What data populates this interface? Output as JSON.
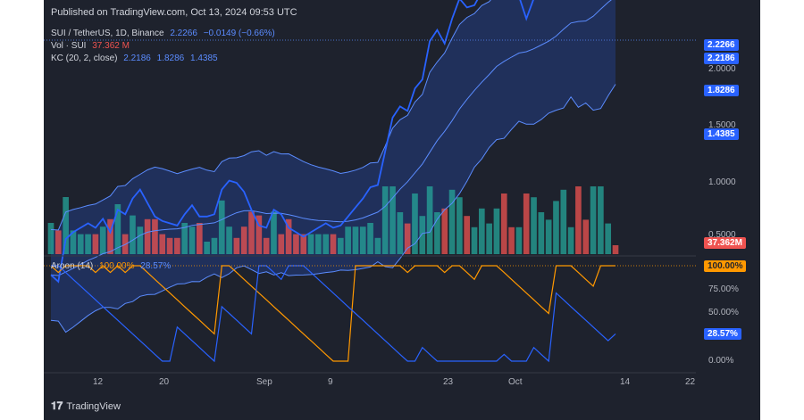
{
  "header": {
    "published": "Published on TradingView.com, Oct 13, 2024 09:53 UTC"
  },
  "legend": {
    "symbol": "SUI / TetherUS, 1D, Binance",
    "price": "2.2266",
    "change": "−0.0149 (−0.66%)",
    "vol_label": "Vol · SUI",
    "vol_value": "37.362 M",
    "kc_label": "KC (20, 2, close)",
    "kc_upper": "2.2186",
    "kc_mid": "1.8286",
    "kc_lower": "1.4385",
    "aroon_label": "Aroon (14)",
    "aroon_up": "100.00%",
    "aroon_down": "28.57%"
  },
  "price_axis": {
    "ticks": [
      "2.0000",
      "1.5000",
      "1.0000",
      "0.5000"
    ],
    "labels": {
      "price": "2.2266",
      "kc_upper": "2.2186",
      "kc_mid": "1.8286",
      "kc_lower": "1.4385",
      "volume": "37.362M"
    }
  },
  "aroon_axis": {
    "ticks": [
      "75.00%",
      "50.00%",
      "0.00%"
    ],
    "labels": {
      "up": "100.00%",
      "down": "28.57%"
    }
  },
  "time_axis": {
    "ticks": [
      "12",
      "20",
      "Sep",
      "9",
      "23",
      "Oct",
      "14",
      "22"
    ]
  },
  "footer": {
    "brand": "TradingView",
    "logo": "tradingview-logo-icon"
  },
  "colors": {
    "background": "#1e222d",
    "price_line": "#2962ff",
    "kc_line": "#5b8cff",
    "volume_up": "#26a69a",
    "volume_down": "#ef5350",
    "aroon_up": "#ff9800",
    "aroon_down": "#2962ff"
  },
  "chart_data": {
    "type": "line",
    "symbol": "SUI / TetherUS",
    "interval": "1D",
    "exchange": "Binance",
    "x_start": "2024-08-04",
    "x_end": "2024-10-13",
    "close": [
      0.59,
      0.56,
      0.75,
      0.78,
      0.8,
      0.82,
      0.8,
      0.84,
      0.78,
      0.88,
      0.86,
      0.93,
      0.97,
      0.91,
      0.85,
      0.83,
      0.82,
      0.81,
      0.86,
      0.9,
      0.85,
      0.85,
      0.86,
      0.97,
      1.01,
      1.0,
      0.96,
      0.88,
      0.81,
      0.8,
      0.88,
      0.86,
      0.8,
      0.78,
      0.76,
      0.78,
      0.8,
      0.82,
      0.8,
      0.81,
      0.85,
      0.89,
      0.93,
      0.98,
      0.99,
      1.14,
      1.29,
      1.34,
      1.32,
      1.42,
      1.46,
      1.63,
      1.68,
      1.62,
      1.73,
      1.82,
      1.78,
      1.79,
      1.85,
      1.87,
      1.93,
      1.83,
      1.82,
      1.83,
      1.73,
      1.82,
      1.87,
      1.9,
      1.98,
      2.09,
      2.1,
      1.91,
      1.88,
      2.08,
      2.22,
      2.24,
      2.2266
    ],
    "kc": {
      "upper": 2.2186,
      "middle": 1.8286,
      "lower": 1.4385
    },
    "volume_last": "37.362M",
    "aroon": {
      "period": 14,
      "up_last": 100.0,
      "down_last": 28.57
    },
    "price_ticks": [
      2.0,
      1.5,
      1.0,
      0.5
    ],
    "aroon_ticks": [
      75,
      50,
      0
    ],
    "grid": false,
    "legend": "top-left"
  }
}
